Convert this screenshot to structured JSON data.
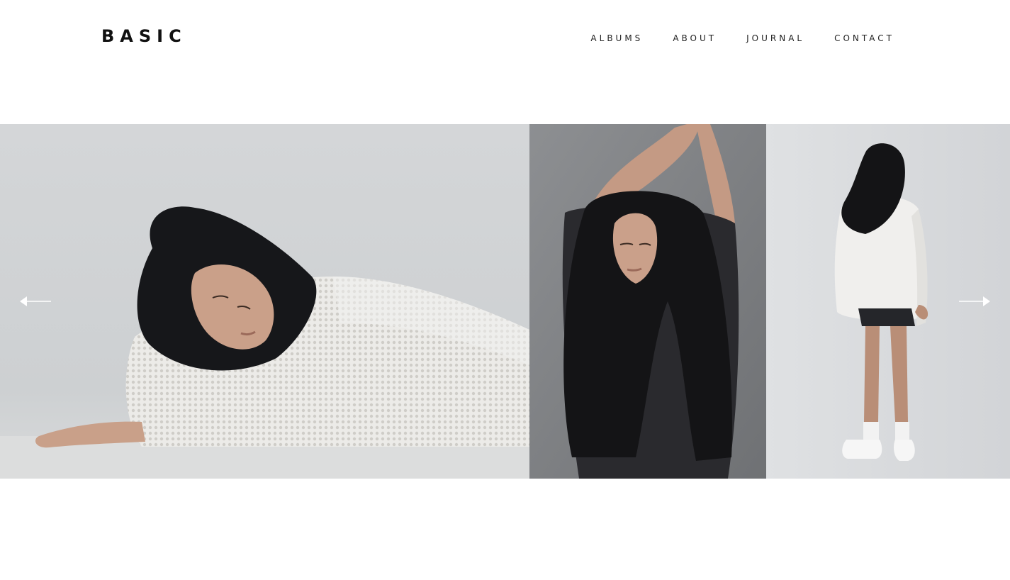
{
  "header": {
    "logo": "BASIC",
    "nav": [
      {
        "label": "ALBUMS"
      },
      {
        "label": "ABOUT"
      },
      {
        "label": "JOURNAL"
      },
      {
        "label": "CONTACT"
      }
    ]
  },
  "gallery": {
    "slides": [
      {
        "icon": "photo-reclining-model"
      },
      {
        "icon": "photo-arms-raised-model"
      },
      {
        "icon": "photo-standing-back-model"
      }
    ],
    "controls": {
      "prev_icon": "arrow-left-icon",
      "next_icon": "arrow-right-icon"
    }
  },
  "colors": {
    "background": "#ffffff",
    "text": "#111111",
    "arrow": "#ffffff"
  }
}
